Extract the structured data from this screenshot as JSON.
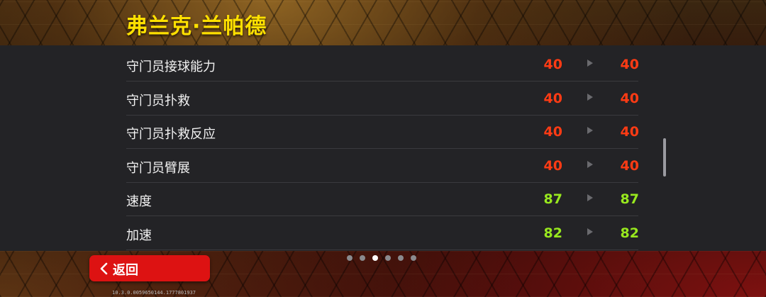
{
  "player": {
    "name": "弗兰克·兰帕德"
  },
  "colors": {
    "title": "#ffe000",
    "value_low": "#ff3b14",
    "value_high": "#98e81e",
    "back_button": "#dd1212"
  },
  "attributes": [
    {
      "label": "守门员接球能力",
      "old": "40",
      "new": "40",
      "tier": "low"
    },
    {
      "label": "守门员扑救",
      "old": "40",
      "new": "40",
      "tier": "low"
    },
    {
      "label": "守门员扑救反应",
      "old": "40",
      "new": "40",
      "tier": "low"
    },
    {
      "label": "守门员臂展",
      "old": "40",
      "new": "40",
      "tier": "low"
    },
    {
      "label": "速度",
      "old": "87",
      "new": "87",
      "tier": "high"
    },
    {
      "label": "加速",
      "old": "82",
      "new": "82",
      "tier": "high"
    }
  ],
  "pagination": {
    "total": 6,
    "active_index": 2
  },
  "back_button": {
    "label": "返回",
    "icon": "chevron-left-icon"
  },
  "version": "10.3.0.0059650144.1777801937"
}
